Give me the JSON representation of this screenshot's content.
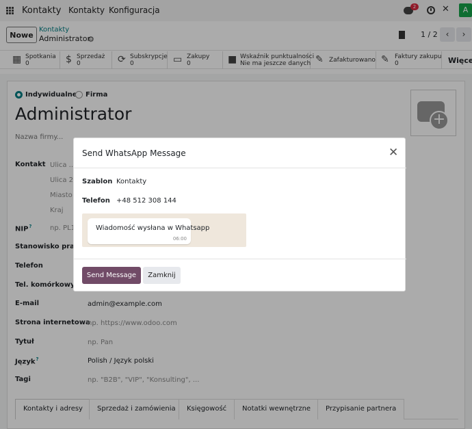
{
  "navbar": {
    "brand": "Kontakty",
    "menu": [
      "Kontakty",
      "Konfiguracja"
    ],
    "chat_badge": "2",
    "avatar_letter": "A"
  },
  "control_panel": {
    "new_label": "Nowe",
    "breadcrumb_parent": "Kontakty",
    "breadcrumb_current": "Administrator",
    "pager": "1 / 2"
  },
  "stats": [
    {
      "label": "Spotkania",
      "value": "0",
      "icon": "calendar-icon"
    },
    {
      "label": "Sprzedaż",
      "value": "0",
      "icon": "dollar-icon"
    },
    {
      "label": "Subskrypcje",
      "value": "0",
      "icon": "refresh-icon"
    },
    {
      "label": "Zakupy",
      "value": "0",
      "icon": "credit-card-icon"
    },
    {
      "label": "Wskaźnik punktualności",
      "value": "Nie ma jeszcze danych",
      "icon": "truck-icon"
    },
    {
      "label": "Zafakturowano",
      "value": "",
      "icon": "edit-icon"
    },
    {
      "label": "Faktury zakupu",
      "value": "0",
      "icon": "edit-icon"
    }
  ],
  "more_label": "Więcej",
  "form": {
    "type_individual": "Indywidualne",
    "type_company": "Firma",
    "name": "Administrator",
    "company_placeholder": "Nazwa firmy...",
    "contact_label": "Kontakt",
    "address_lines": [
      "Ulica ...",
      "Ulica 2...",
      "Miasto",
      "Kraj"
    ],
    "nip_label": "NIP",
    "nip_placeholder": "np. PL1",
    "position_label": "Stanowisko pracy",
    "phone_label": "Telefon",
    "mobile_label": "Tel. komórkowy",
    "email_label": "E-mail",
    "email_value": "admin@example.com",
    "website_label": "Strona internetowa",
    "website_placeholder": "np. https://www.odoo.com",
    "title_label": "Tytuł",
    "title_placeholder": "np. Pan",
    "language_label": "Język",
    "language_value": "Polish / Język polski",
    "tags_label": "Tagi",
    "tags_placeholder": "np. \"B2B\", \"VIP\", \"Konsulting\", ..."
  },
  "tabs": [
    "Kontakty i adresy",
    "Sprzedaż i zamówienia",
    "Księgowość",
    "Notatki wewnętrzne",
    "Przypisanie partnera"
  ],
  "modal": {
    "title": "Send WhatsApp Message",
    "template_label": "Szablon",
    "template_value": "Kontakty",
    "phone_label": "Telefon",
    "phone_value": "+48 512 308 144",
    "preview_text": "Wiadomość wysłana w Whatsapp",
    "preview_time": "06:00",
    "send_label": "Send Message",
    "close_label": "Zamknij"
  },
  "colors": {
    "accent": "#714b67",
    "link": "#017e84",
    "badge": "#d9293f",
    "avatar": "#16a34a"
  }
}
